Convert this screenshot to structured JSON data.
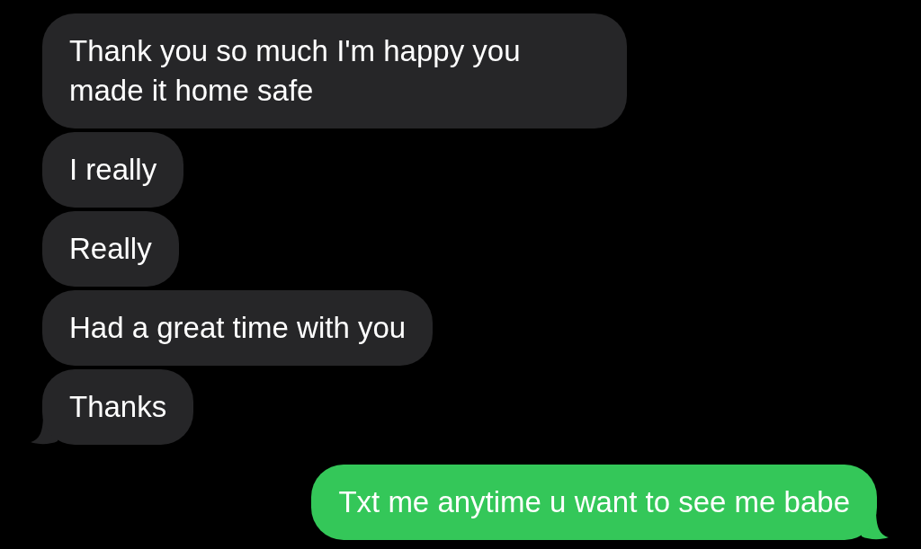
{
  "messages": [
    {
      "text": "Thank you so much I'm happy you made it home safe",
      "kind": "incoming",
      "tail": false
    },
    {
      "text": "I really",
      "kind": "incoming",
      "tail": false
    },
    {
      "text": "Really",
      "kind": "incoming",
      "tail": false
    },
    {
      "text": "Had a great time with you",
      "kind": "incoming",
      "tail": false
    },
    {
      "text": "Thanks",
      "kind": "incoming",
      "tail": true
    },
    {
      "text": "Txt me anytime u want to see me babe",
      "kind": "outgoing",
      "tail": true
    }
  ]
}
